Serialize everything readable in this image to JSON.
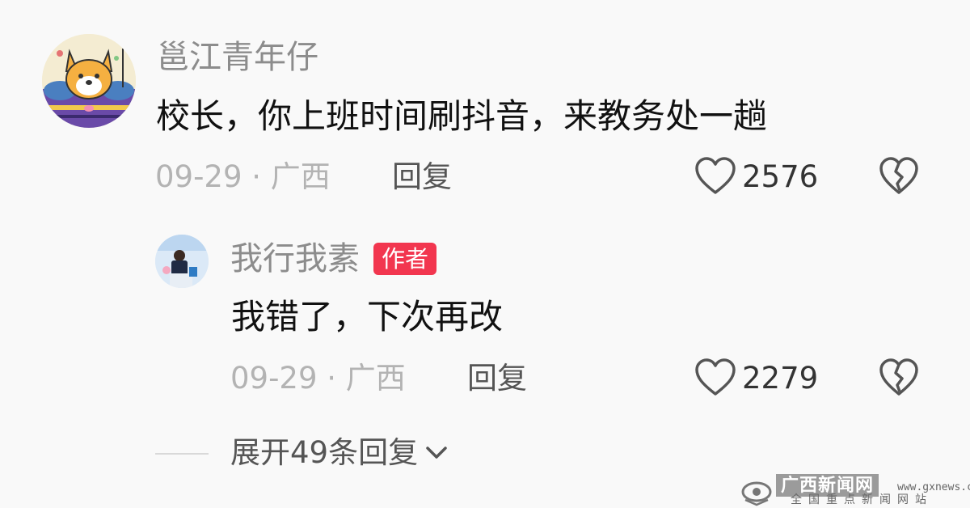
{
  "comment": {
    "username": "邕江青年仔",
    "text": "校长，你上班时间刷抖音，来教务处一趟",
    "date_location": "09-29 · 广西",
    "reply_label": "回复",
    "like_count": "2576",
    "icons": {
      "like": "heart-outline-icon",
      "dislike": "broken-heart-icon"
    }
  },
  "reply": {
    "username": "我行我素",
    "badge": "作者",
    "badge_color": "#f2364f",
    "text": "我错了，下次再改",
    "date_location": "09-29 · 广西",
    "reply_label": "回复",
    "like_count": "2279",
    "icons": {
      "like": "heart-outline-icon",
      "dislike": "broken-heart-icon"
    }
  },
  "expand_replies": {
    "label": "展开49条回复",
    "icon": "chevron-down-icon"
  },
  "watermark": {
    "logo_text": "广西新闻网",
    "url": "www.gxnews.com.cn",
    "tagline": "全国重点新闻网站"
  }
}
